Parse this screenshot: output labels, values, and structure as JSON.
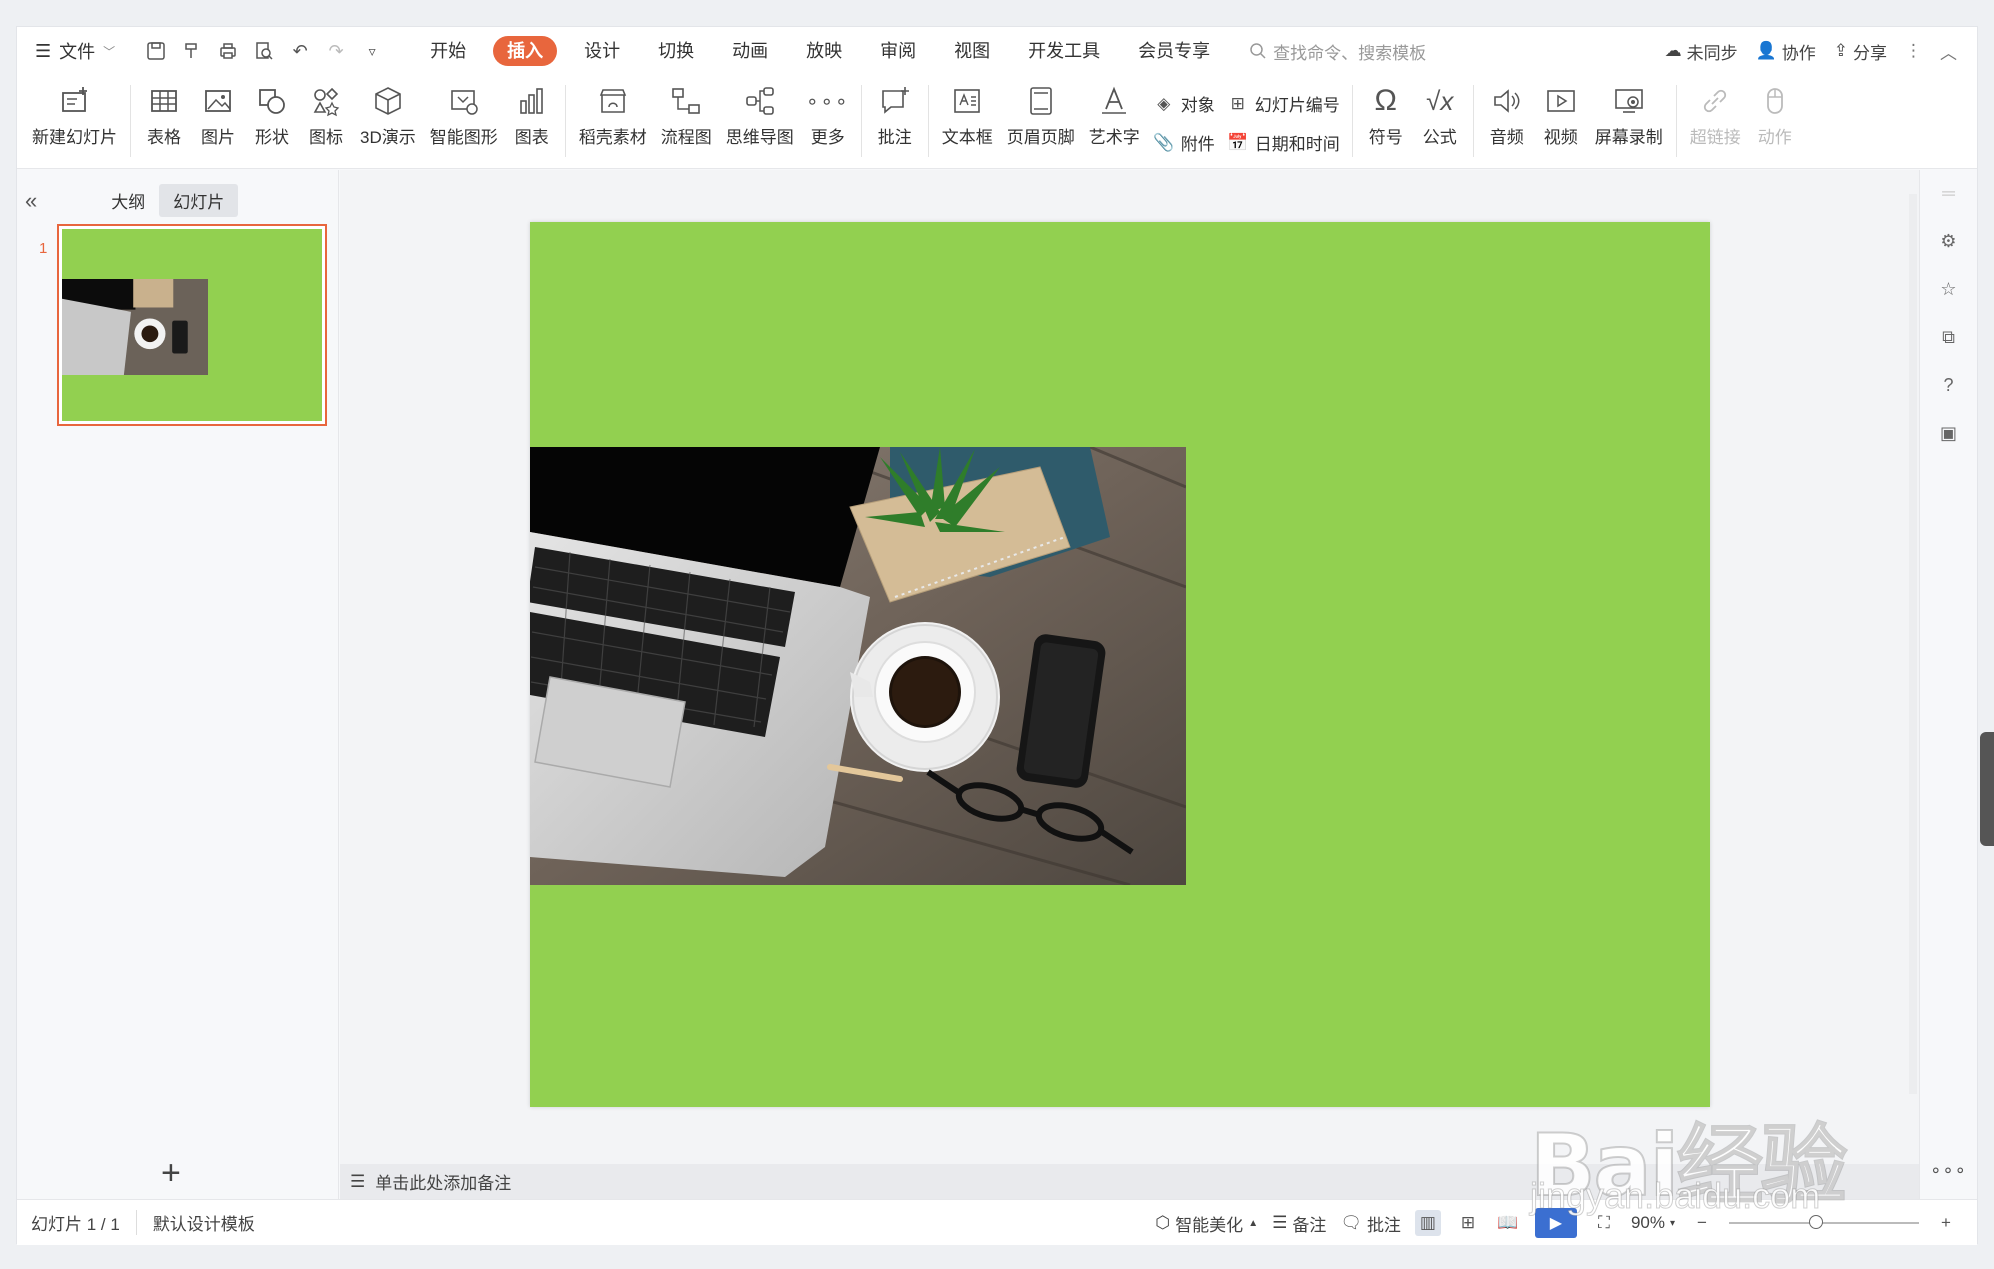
{
  "menubar": {
    "file_label": "文件",
    "tabs": [
      "开始",
      "插入",
      "设计",
      "切换",
      "动画",
      "放映",
      "审阅",
      "视图",
      "开发工具",
      "会员专享"
    ],
    "active_tab": "插入",
    "search_placeholder": "查找命令、搜索模板",
    "right": {
      "sync": "未同步",
      "collab": "协作",
      "share": "分享"
    }
  },
  "ribbon": {
    "new_slide": "新建幻灯片",
    "table": "表格",
    "picture": "图片",
    "shape": "形状",
    "icon": "图标",
    "demo3d": "3D演示",
    "smartart": "智能图形",
    "chart": "图表",
    "material": "稻壳素材",
    "flowchart": "流程图",
    "mindmap": "思维导图",
    "more": "更多",
    "comment": "批注",
    "textbox": "文本框",
    "header_footer": "页眉页脚",
    "wordart": "艺术字",
    "object": "对象",
    "slide_number": "幻灯片编号",
    "attachment": "附件",
    "datetime": "日期和时间",
    "symbol": "符号",
    "formula": "公式",
    "audio": "音频",
    "video": "视频",
    "screen_record": "屏幕录制",
    "hyperlink": "超链接",
    "action": "动作"
  },
  "leftpane": {
    "tab_outline": "大纲",
    "tab_slides": "幻灯片",
    "slide_number": "1"
  },
  "slide": {
    "background": "#92d050"
  },
  "notes": {
    "placeholder": "单击此处添加备注"
  },
  "status": {
    "slide_info": "幻灯片 1 / 1",
    "template": "默认设计模板",
    "beautify": "智能美化",
    "notes": "备注",
    "comments": "批注",
    "zoom": "90%"
  },
  "watermark": {
    "brand": "Bai经验",
    "url": "jingyan.baidu.com"
  },
  "colors": {
    "accent": "#e8663d",
    "slide_green": "#92d050",
    "play_blue": "#3b6fd1"
  }
}
